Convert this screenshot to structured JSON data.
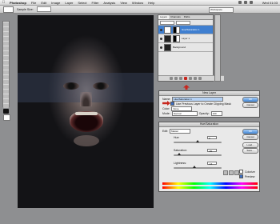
{
  "menubar": {
    "apple": "",
    "items": [
      "Photoshop",
      "File",
      "Edit",
      "Image",
      "Layer",
      "Select",
      "Filter",
      "Analysis",
      "View",
      "Window",
      "Help"
    ],
    "clock": "Wed 01:03"
  },
  "options": {
    "sample_label": "Sample Size:",
    "workspace": "Workspace"
  },
  "layers": {
    "tabs": [
      "Layers",
      "Channels",
      "Paths"
    ],
    "rows": [
      {
        "name": "Hue/Saturation 1",
        "selected": true
      },
      {
        "name": "Layer 1"
      },
      {
        "name": "Background"
      }
    ]
  },
  "newlayer": {
    "title": "New Layer",
    "name_label": "Name:",
    "name_value": "Hue/Saturation 1",
    "clip_label": "Use Previous Layer to Create Clipping Mask",
    "color_label": "Color:",
    "color_value": "None",
    "mode_label": "Mode:",
    "mode_value": "Normal",
    "opacity_label": "Opacity:",
    "opacity_value": "100",
    "ok": "OK",
    "cancel": "Cancel"
  },
  "huesat": {
    "title": "Hue/Saturation",
    "edit_label": "Edit:",
    "edit_value": "Master",
    "hue_label": "Hue:",
    "hue_value": "0",
    "sat_label": "Saturation:",
    "sat_value": "-81",
    "light_label": "Lightness:",
    "light_value": "-14",
    "ok": "OK",
    "cancel": "Cancel",
    "load": "Load...",
    "save": "Save...",
    "colorize": "Colorize",
    "preview": "Preview"
  },
  "colors": {
    "accent": "#3f7fd0",
    "arrow": "#c8261d"
  }
}
